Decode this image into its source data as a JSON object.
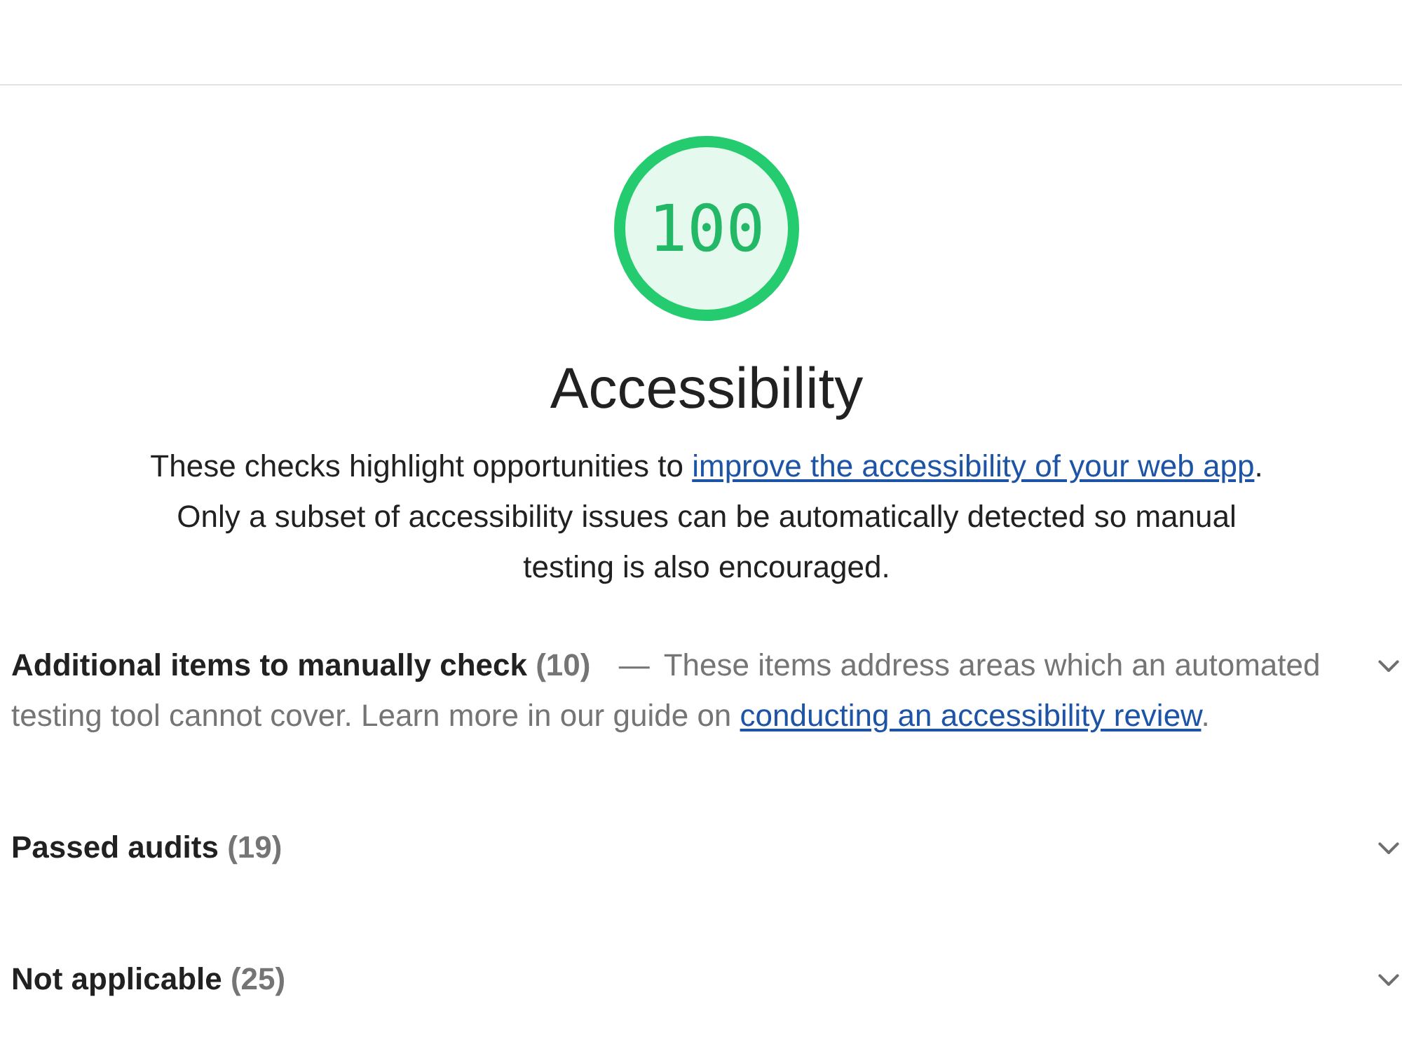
{
  "score_gauge": {
    "score": "100",
    "level": 1
  },
  "category_title": "Accessibility",
  "description": {
    "before": "These checks highlight opportunities to ",
    "link": "improve the accessibility of your web app",
    "after": ". Only a subset of accessibility issues can be automatically detected so manual testing is also encouraged."
  },
  "groups": [
    {
      "title": "Additional items to manually check",
      "count": "(10)",
      "separator": "—",
      "description": "These items address areas which an automated testing tool cannot cover. Learn more in our guide on ",
      "link": "conducting an accessibility review",
      "description_end": ".",
      "expanded": false
    },
    {
      "title": "Passed audits",
      "count": "(19)",
      "expanded": false
    },
    {
      "title": "Not applicable",
      "count": "(25)",
      "expanded": false
    }
  ]
}
